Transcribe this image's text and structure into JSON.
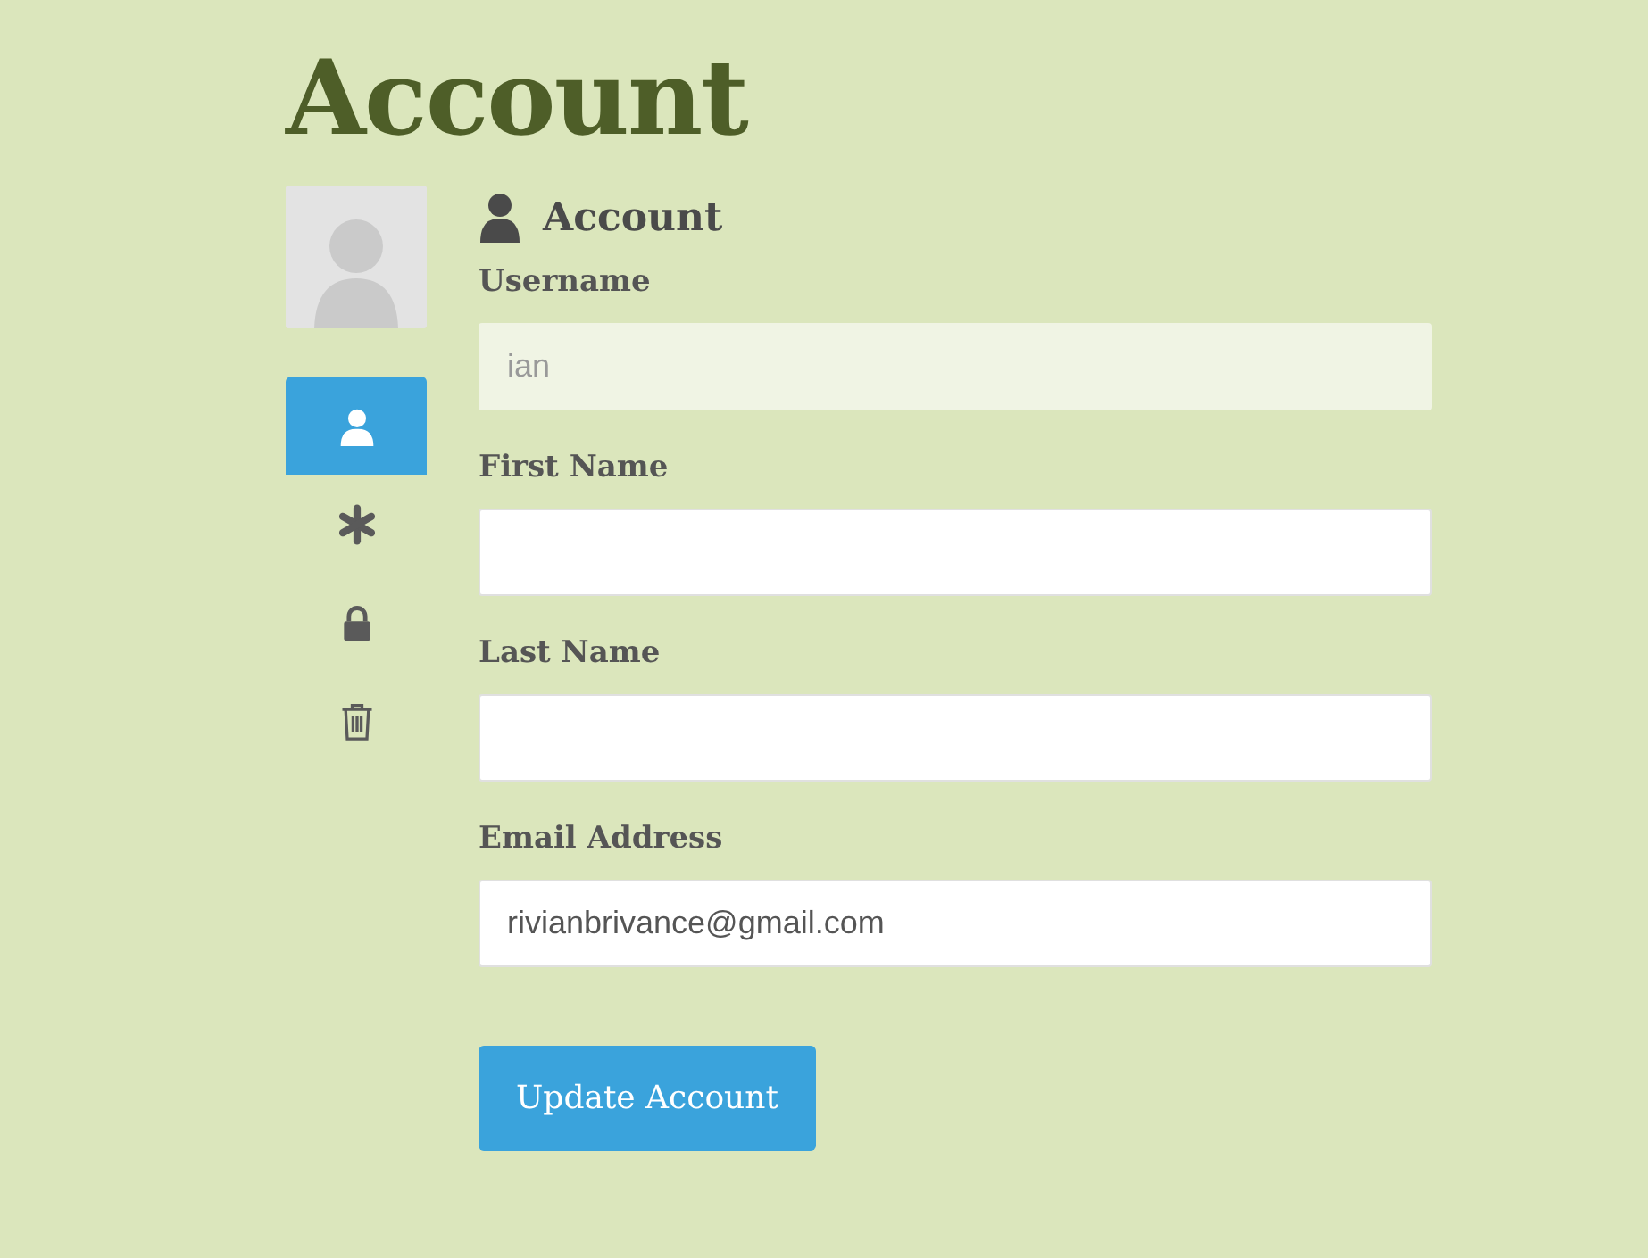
{
  "page_title": "Account",
  "sidebar": {
    "tabs": [
      {
        "kind": "user",
        "selected": true
      },
      {
        "kind": "asterisk",
        "selected": false
      },
      {
        "kind": "lock",
        "selected": false
      },
      {
        "kind": "trash",
        "selected": false
      }
    ]
  },
  "section": {
    "title": "Account"
  },
  "fields": [
    {
      "label": "Username",
      "value": "ian",
      "disabled": true
    },
    {
      "label": "First Name",
      "disabled": false
    },
    {
      "label": "Last Name",
      "disabled": false
    },
    {
      "label": "Email Address",
      "value": "rivianbrivance@gmail.com",
      "disabled": false
    }
  ],
  "submit_button": "Update Account"
}
